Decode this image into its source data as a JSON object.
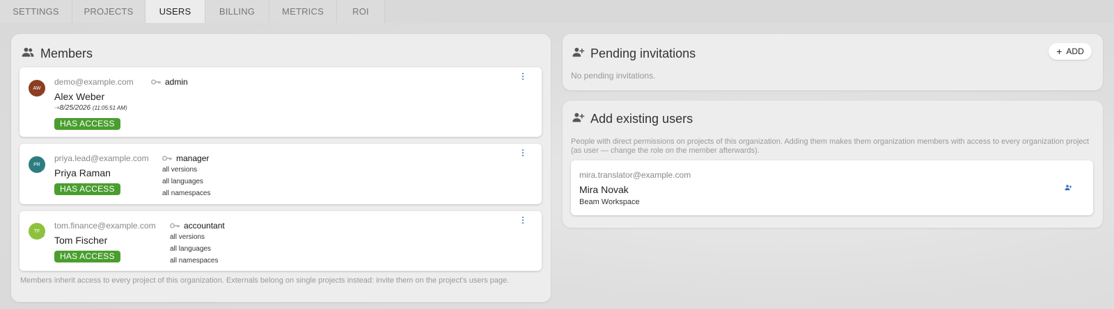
{
  "tabs": [
    {
      "label": "SETTINGS"
    },
    {
      "label": "PROJECTS"
    },
    {
      "label": "USERS"
    },
    {
      "label": "BILLING"
    },
    {
      "label": "METRICS"
    },
    {
      "label": "ROI"
    }
  ],
  "members": {
    "title": "Members",
    "items": [
      {
        "initials": "AW",
        "avatar_color": "#8b3e22",
        "email": "demo@example.com",
        "name": "Alex Weber",
        "role": "admin",
        "last_login_date": "8/25/2026",
        "last_login_time": "(11:05:51 AM)",
        "status": "HAS ACCESS"
      },
      {
        "initials": "PR",
        "avatar_color": "#2c7d80",
        "email": "priya.lead@example.com",
        "name": "Priya Raman",
        "role": "manager",
        "scopes": [
          "all versions",
          "all languages",
          "all namespaces"
        ],
        "status": "HAS ACCESS"
      },
      {
        "initials": "TF",
        "avatar_color": "#8dc23c",
        "email": "tom.finance@example.com",
        "name": "Tom Fischer",
        "role": "accountant",
        "scopes": [
          "all versions",
          "all languages",
          "all namespaces"
        ],
        "status": "HAS ACCESS"
      }
    ],
    "footnote": "Members inherit access to every project of this organization. Externals belong on single projects instead: invite them on the project's users page."
  },
  "pending": {
    "title": "Pending invitations",
    "add_label": "ADD",
    "empty_text": "No pending invitations."
  },
  "existing": {
    "title": "Add existing users",
    "description": "People with direct permissions on projects of this organization. Adding them makes them organization members with access to every organization project (as user — change the role on the member afterwards).",
    "users": [
      {
        "email": "mira.translator@example.com",
        "name": "Mira Novak",
        "workspace": "Beam Workspace"
      }
    ]
  },
  "colors": {
    "badge_green": "#4a9e2f",
    "accent_blue": "#2f6fb5"
  }
}
